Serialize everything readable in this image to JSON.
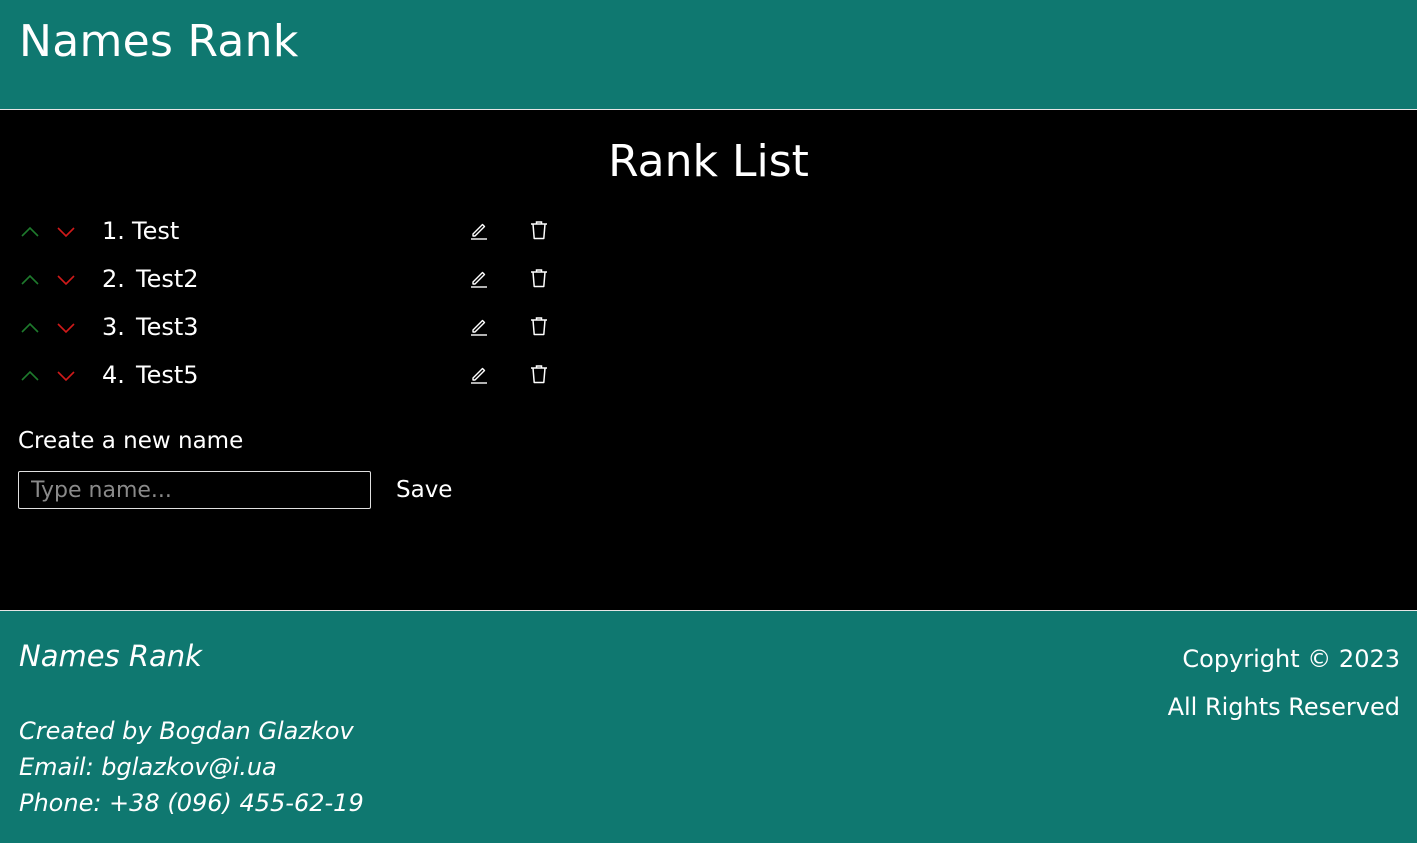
{
  "header": {
    "title": "Names Rank"
  },
  "main": {
    "title": "Rank List",
    "items": [
      {
        "number": "1.",
        "name": "Test"
      },
      {
        "number": "2.",
        "name": "Test2"
      },
      {
        "number": "3.",
        "name": "Test3"
      },
      {
        "number": "4.",
        "name": "Test5"
      }
    ],
    "create_label": "Create a new name",
    "input": {
      "placeholder": "Type name...",
      "value": ""
    },
    "save_label": "Save"
  },
  "footer": {
    "brand": "Names Rank",
    "created_by": "Created by Bogdan Glazkov",
    "email": "Email: bglazkov@i.ua",
    "phone": "Phone: +38 (096) 455-62-19",
    "copyright": "Copyright © 2023",
    "rights": "All Rights Reserved"
  },
  "icons": {
    "up": "chevron-up-icon",
    "down": "chevron-down-icon",
    "edit": "pencil-icon",
    "delete": "trash-icon"
  },
  "colors": {
    "brand": "#0f7870",
    "background": "#000000",
    "up_arrow": "#1e7a2c",
    "down_arrow": "#d01a1a",
    "text": "#ffffff"
  }
}
